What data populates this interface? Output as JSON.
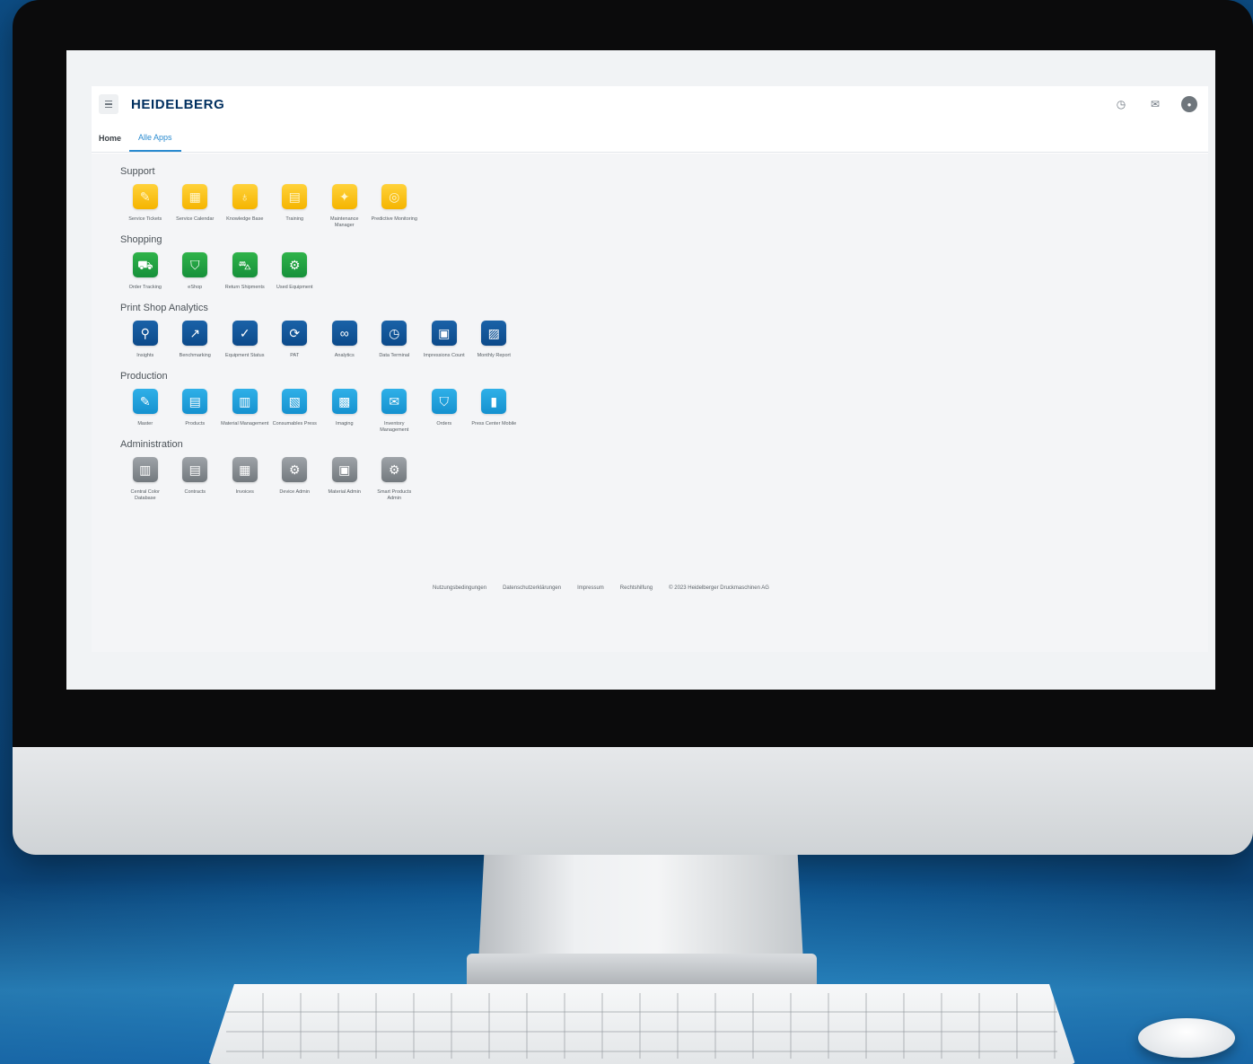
{
  "header": {
    "brand": "HEIDELBERG",
    "menu_icon": "hamburger-icon",
    "right_icons": [
      "help-icon",
      "mail-icon",
      "avatar-icon"
    ]
  },
  "tabs": [
    {
      "label": "Home"
    },
    {
      "label": "Alle Apps"
    }
  ],
  "sections": [
    {
      "title": "Support",
      "color": "#f5b400",
      "apps": [
        {
          "label": "Service Tickets",
          "icon": "ticket-icon",
          "glyph": "✎"
        },
        {
          "label": "Service Calendar",
          "icon": "calendar-icon",
          "glyph": "▦"
        },
        {
          "label": "Knowledge Base",
          "icon": "lightbulb-icon",
          "glyph": "♁"
        },
        {
          "label": "Training",
          "icon": "training-icon",
          "glyph": "▤"
        },
        {
          "label": "Maintenance Manager",
          "icon": "wrench-icon",
          "glyph": "✦"
        },
        {
          "label": "Predictive Monitoring",
          "icon": "monitoring-icon",
          "glyph": "◎"
        }
      ]
    },
    {
      "title": "Shopping",
      "color": "#16903a",
      "apps": [
        {
          "label": "Order Tracking",
          "icon": "truck-icon",
          "glyph": "⛟"
        },
        {
          "label": "eShop",
          "icon": "cart-icon",
          "glyph": "⛉"
        },
        {
          "label": "Return Shipments",
          "icon": "return-icon",
          "glyph": "⛍"
        },
        {
          "label": "Used Equipment",
          "icon": "equipment-icon",
          "glyph": "⚙"
        }
      ]
    },
    {
      "title": "Print Shop Analytics",
      "color": "#0c4a8a",
      "apps": [
        {
          "label": "Insights",
          "icon": "insights-icon",
          "glyph": "⚲"
        },
        {
          "label": "Benchmarking",
          "icon": "benchmark-icon",
          "glyph": "↗"
        },
        {
          "label": "Equipment Status",
          "icon": "status-icon",
          "glyph": "✓"
        },
        {
          "label": "PAT",
          "icon": "pat-icon",
          "glyph": "⟳"
        },
        {
          "label": "Analytics",
          "icon": "analytics-icon",
          "glyph": "∞"
        },
        {
          "label": "Data Terminal",
          "icon": "timer-icon",
          "glyph": "◷"
        },
        {
          "label": "Impressions Count",
          "icon": "count-icon",
          "glyph": "▣"
        },
        {
          "label": "Monthly Report",
          "icon": "report-icon",
          "glyph": "▨"
        }
      ]
    },
    {
      "title": "Production",
      "color": "#1591cf",
      "apps": [
        {
          "label": "Master",
          "icon": "master-icon",
          "glyph": "✎"
        },
        {
          "label": "Products",
          "icon": "products-icon",
          "glyph": "▤"
        },
        {
          "label": "Material Management",
          "icon": "material-icon",
          "glyph": "▥"
        },
        {
          "label": "Consumables Press",
          "icon": "consumables-icon",
          "glyph": "▧"
        },
        {
          "label": "Imaging",
          "icon": "imaging-icon",
          "glyph": "▩"
        },
        {
          "label": "Inventory Management",
          "icon": "inventory-icon",
          "glyph": "✉"
        },
        {
          "label": "Orders",
          "icon": "orders-icon",
          "glyph": "⛉"
        },
        {
          "label": "Press Center Mobile",
          "icon": "mobile-icon",
          "glyph": "▮"
        }
      ]
    },
    {
      "title": "Administration",
      "color": "#73797e",
      "apps": [
        {
          "label": "Central Color Database",
          "icon": "color-db-icon",
          "glyph": "▥"
        },
        {
          "label": "Contracts",
          "icon": "contracts-icon",
          "glyph": "▤"
        },
        {
          "label": "Invoices",
          "icon": "invoice-icon",
          "glyph": "▦"
        },
        {
          "label": "Device Admin",
          "icon": "device-icon",
          "glyph": "⚙"
        },
        {
          "label": "Material Admin",
          "icon": "material-admin-icon",
          "glyph": "▣"
        },
        {
          "label": "Smart Products Admin",
          "icon": "smart-products-icon",
          "glyph": "⚙"
        }
      ]
    }
  ],
  "footer": {
    "links": [
      "Nutzungsbedingungen",
      "Datenschutzerklärungen",
      "Impressum",
      "Rechtshilfung"
    ],
    "copyright": "© 2023 Heidelberger Druckmaschinen AG"
  }
}
